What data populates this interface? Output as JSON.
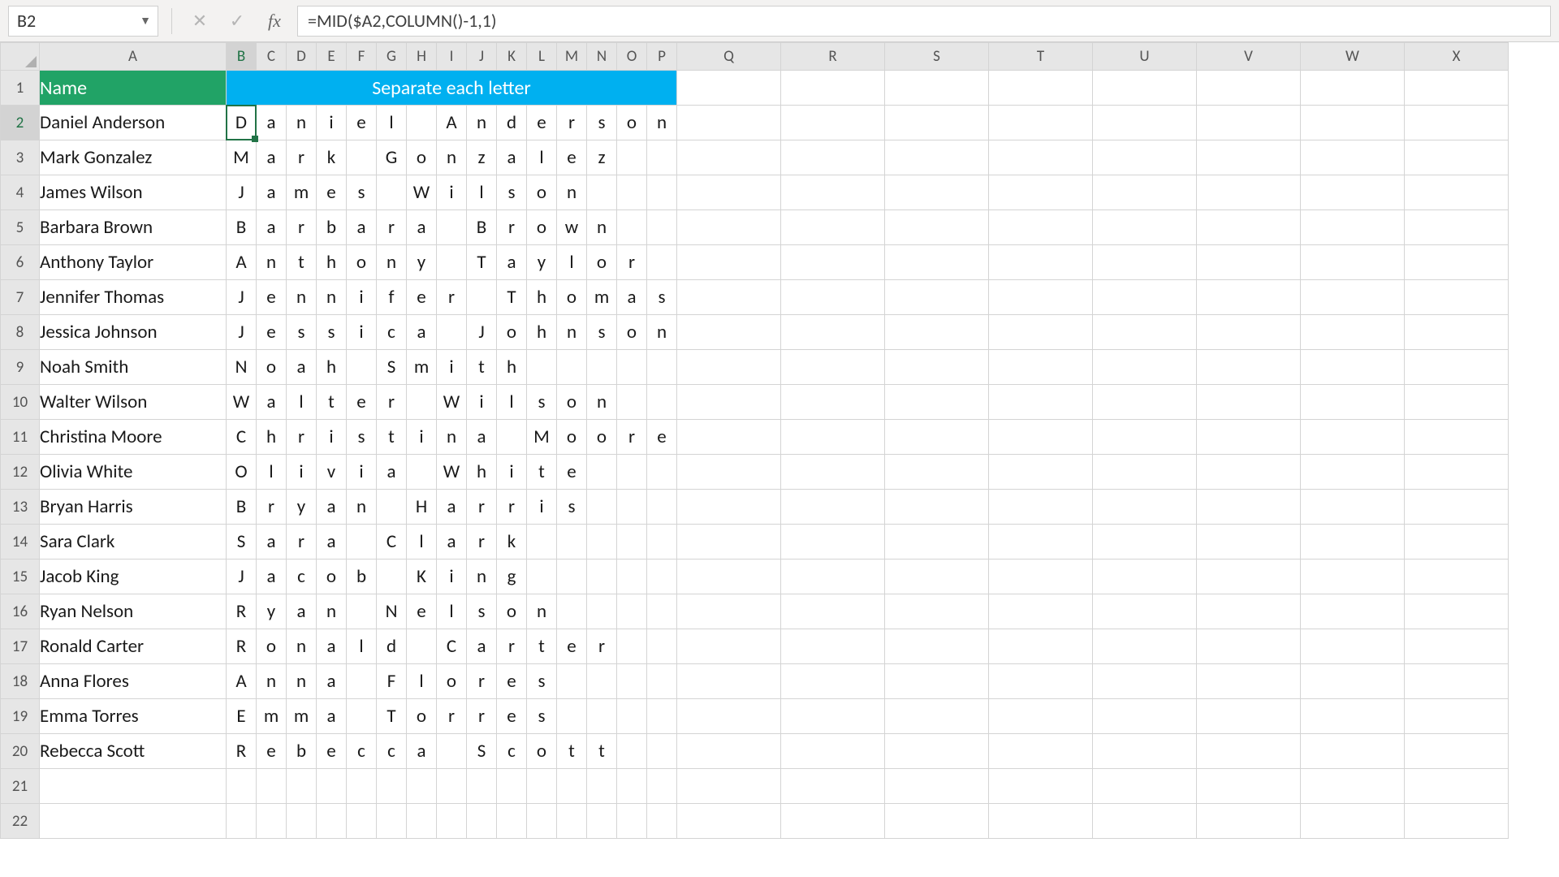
{
  "formula_bar": {
    "cell_ref": "B2",
    "fx_label": "fx",
    "formula": "=MID($A2,COLUMN()-1,1)"
  },
  "columns": {
    "corner": "",
    "big": [
      "A"
    ],
    "letters": [
      "B",
      "C",
      "D",
      "E",
      "F",
      "G",
      "H",
      "I",
      "J",
      "K",
      "L",
      "M",
      "N",
      "O",
      "P"
    ],
    "rest": [
      "Q",
      "R",
      "S",
      "T",
      "U",
      "V",
      "W",
      "X"
    ]
  },
  "headers": {
    "name": "Name",
    "separate": "Separate each letter"
  },
  "active": {
    "col": "B",
    "row": 2
  },
  "names": [
    "Daniel Anderson",
    "Mark Gonzalez",
    "James Wilson",
    "Barbara Brown",
    "Anthony Taylor",
    "Jennifer Thomas",
    "Jessica Johnson",
    "Noah Smith",
    "Walter Wilson",
    "Christina Moore",
    "Olivia White",
    "Bryan Harris",
    "Sara Clark",
    "Jacob King",
    "Ryan Nelson",
    "Ronald Carter",
    "Anna Flores",
    "Emma Torres",
    "Rebecca Scott"
  ],
  "empty_rows": [
    21,
    22
  ],
  "col_widths": {
    "rowhdr": 48,
    "A": 230,
    "letter": 37,
    "Q": 128,
    "rest": 128
  }
}
